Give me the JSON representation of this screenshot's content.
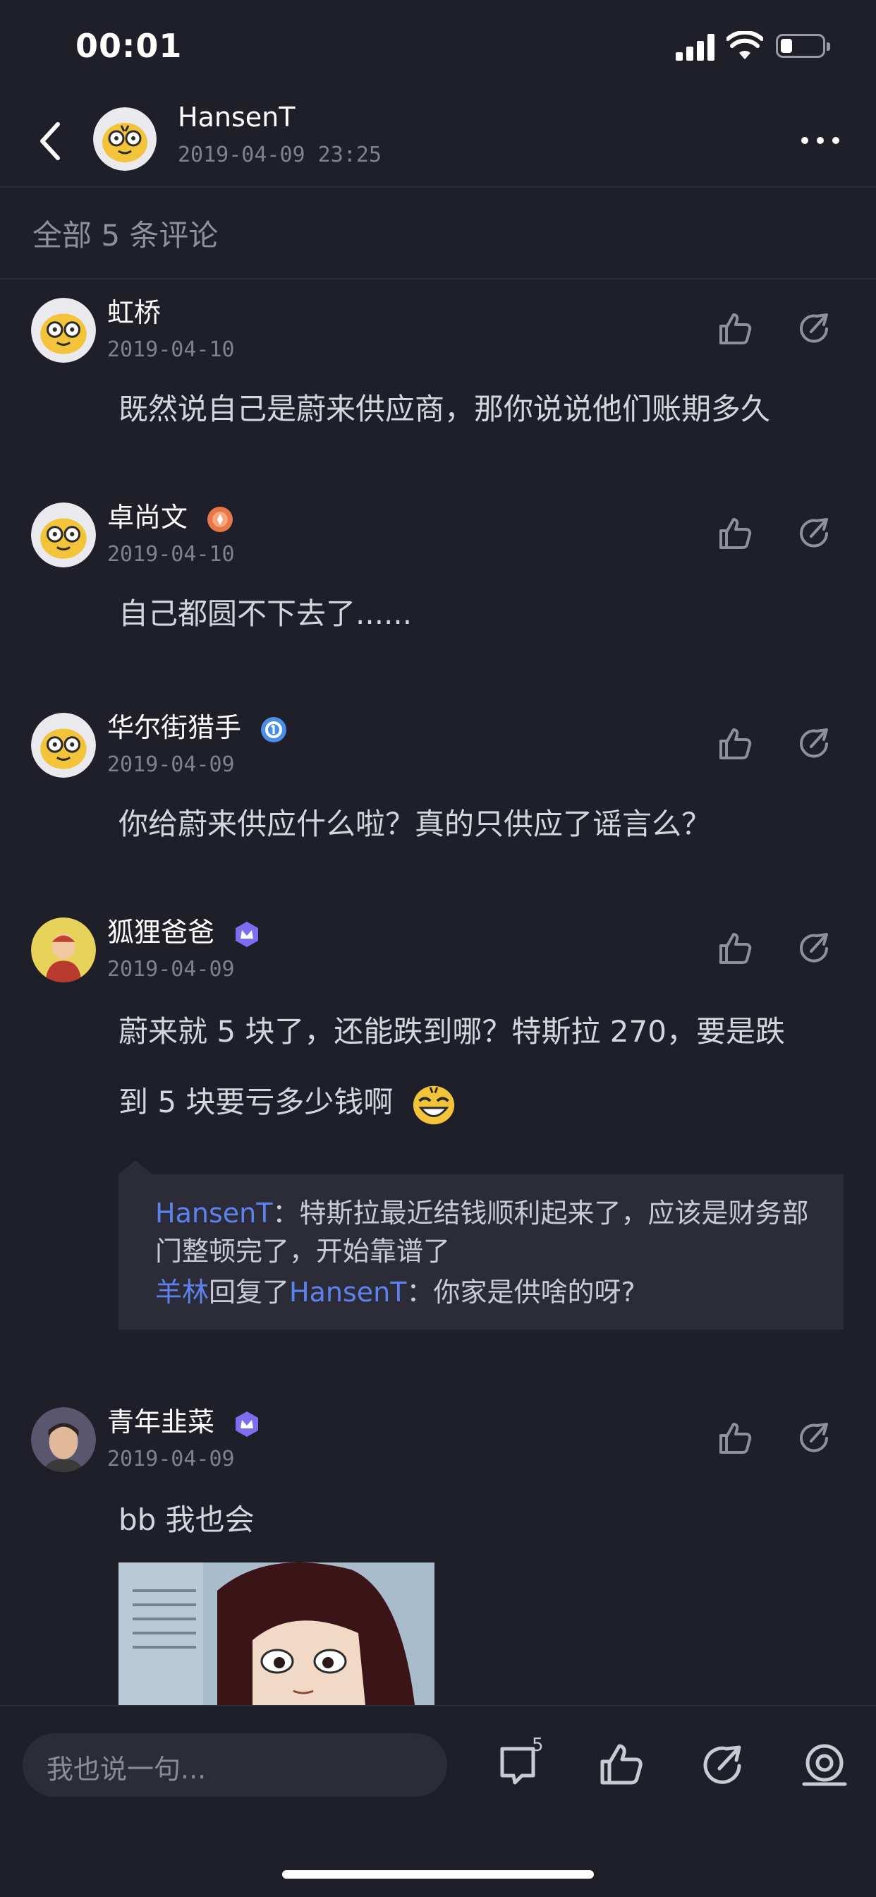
{
  "status_bar": {
    "time": "00:01"
  },
  "header": {
    "author": "HansenT",
    "datetime": "2019-04-09 23:25"
  },
  "section": {
    "title": "全部 5 条评论"
  },
  "comments": [
    {
      "name": "虹桥",
      "date": "2019-04-10",
      "lines": [
        "既然说自己是蔚来供应商，那你说说他们账期多久"
      ]
    },
    {
      "name": "卓尚文",
      "date": "2019-04-10",
      "lines": [
        "自己都圆不下去了......"
      ],
      "badge": "orange-badge"
    },
    {
      "name": "华尔街猎手",
      "date": "2019-04-09",
      "lines": [
        "你给蔚来供应什么啦？真的只供应了谣言么？"
      ],
      "badge": "blue-badge"
    },
    {
      "name": "狐狸爸爸",
      "date": "2019-04-09",
      "lines": [
        "蔚来就 5 块了，还能跌到哪？特斯拉 270，要是跌",
        "到 5 块要亏多少钱啊"
      ],
      "badge": "purple-badge"
    },
    {
      "name": "青年韭菜",
      "date": "2019-04-09",
      "lines": [
        "bb 我也会"
      ],
      "badge": "purple-badge"
    }
  ],
  "reply_box": {
    "r1_user": "HansenT",
    "r1_sep": "：",
    "r1_text": "特斯拉最近结钱顺利起来了，应该是财务部门整顿完了，开始靠谱了",
    "r2_user": "羊林",
    "r2_mid": "回复了",
    "r2_target": "HansenT",
    "r2_sep": "：",
    "r2_text": "你家是供啥的呀?"
  },
  "bottom_bar": {
    "input_placeholder": "我也说一句...",
    "comment_count": "5"
  },
  "colors": {
    "background": "#1f1f29",
    "accent_blue": "#5d82ee",
    "muted": "#7f8090"
  },
  "icons": [
    "back-icon",
    "more-icon",
    "like-icon",
    "share-icon",
    "comment-icon",
    "favorite-icon"
  ]
}
